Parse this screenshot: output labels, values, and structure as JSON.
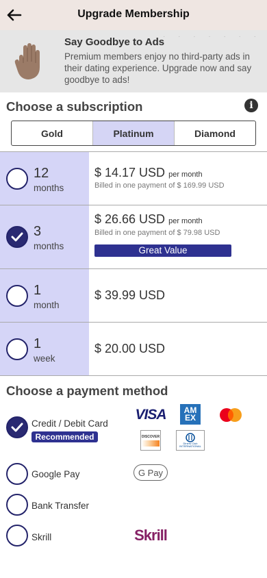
{
  "header": {
    "title": "Upgrade Membership"
  },
  "promo": {
    "title": "Say Goodbye to Ads",
    "text": "Premium members enjoy no third-party ads in their dating experience. Upgrade now and say goodbye to ads!"
  },
  "subscription": {
    "title": "Choose a subscription",
    "tabs": [
      {
        "label": "Gold",
        "active": false
      },
      {
        "label": "Platinum",
        "active": true
      },
      {
        "label": "Diamond",
        "active": false
      }
    ],
    "plans": [
      {
        "number": "12",
        "unit": "months",
        "price": "$ 14.17 USD",
        "per": "per month",
        "billed": "Billed in one payment of $ 169.99 USD",
        "selected": false
      },
      {
        "number": "3",
        "unit": "months",
        "price": "$ 26.66 USD",
        "per": "per month",
        "billed": "Billed in one payment of $ 79.98 USD",
        "badge": "Great Value",
        "selected": true
      },
      {
        "number": "1",
        "unit": "month",
        "price": "$ 39.99 USD",
        "selected": false
      },
      {
        "number": "1",
        "unit": "week",
        "price": "$ 20.00 USD",
        "selected": false
      }
    ]
  },
  "payment": {
    "title": "Choose a payment method",
    "methods": [
      {
        "label": "Credit / Debit Card",
        "badge": "Recommended",
        "selected": true
      },
      {
        "label": "Google Pay",
        "selected": false
      },
      {
        "label": "Bank Transfer",
        "selected": false
      },
      {
        "label": "Skrill",
        "selected": false
      }
    ],
    "logos": {
      "visa": "VISA",
      "amex": "AM EX",
      "discover": "DISCOVER",
      "diners": "Diners Club INTERNATIONAL",
      "gpay": "G Pay",
      "skrill": "Skrill"
    }
  },
  "colors": {
    "accent": "#2e3190",
    "plan_highlight": "#d5d5f7",
    "header_bg": "#efe6e2",
    "skrill": "#862165"
  }
}
